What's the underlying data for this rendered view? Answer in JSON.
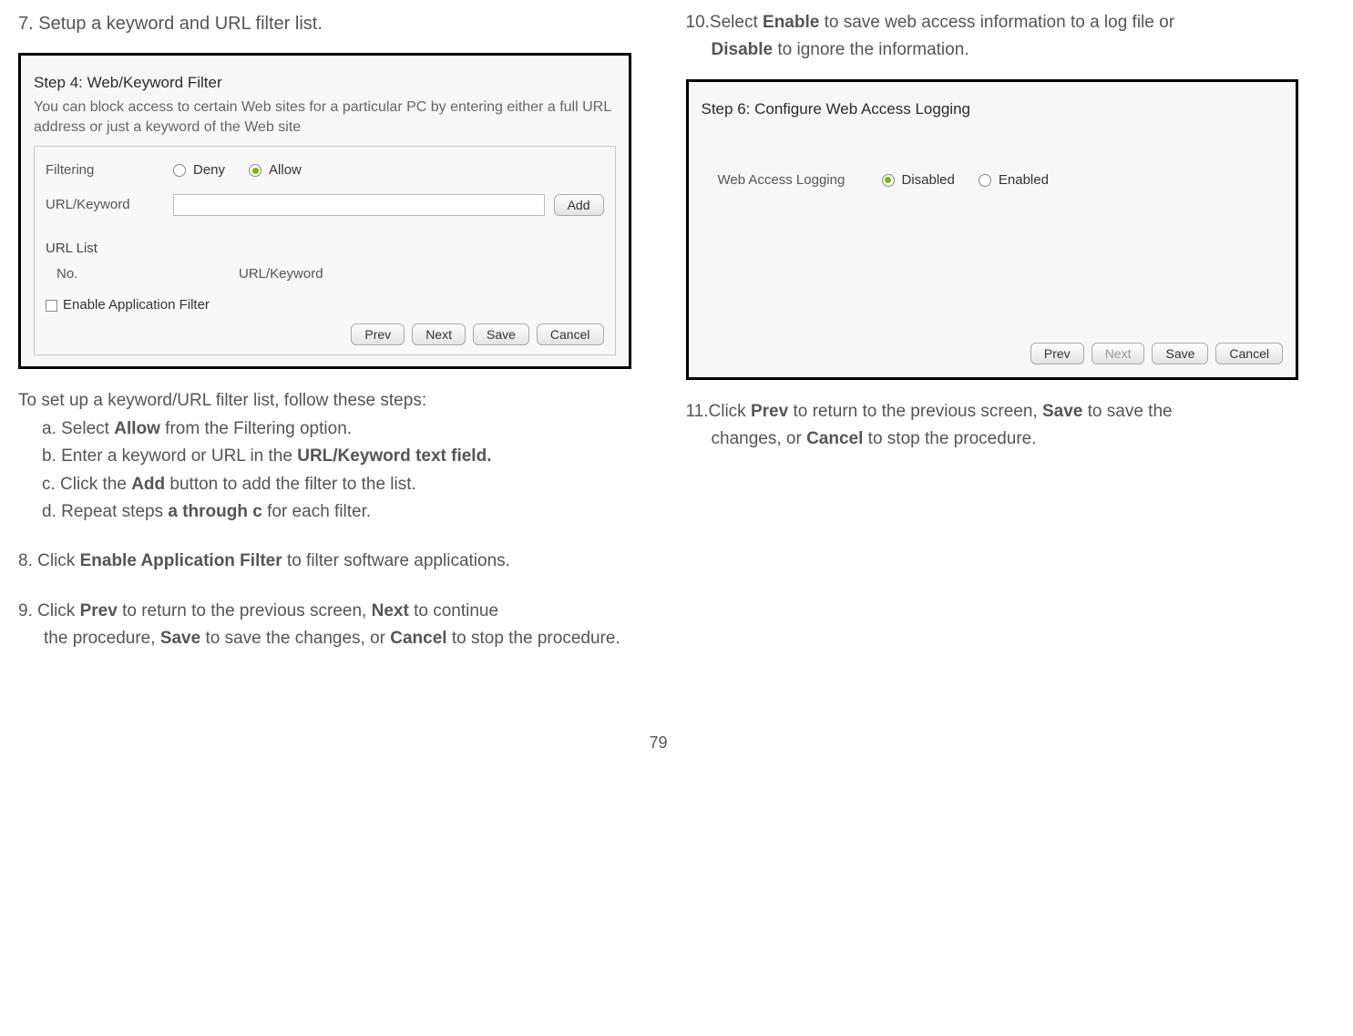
{
  "left": {
    "step7": {
      "num": "7.",
      "text": "Setup a keyword and URL filter list."
    },
    "screenshot1": {
      "title": "Step 4: Web/Keyword Filter",
      "desc": "You can block access to certain Web sites for a particular PC by entering either a full URL address or just a keyword of the Web site",
      "filtering_label": "Filtering",
      "deny": "Deny",
      "allow": "Allow",
      "url_keyword_label": "URL/Keyword",
      "add_btn": "Add",
      "url_list_label": "URL List",
      "col_no": "No.",
      "col_urlkw": "URL/Keyword",
      "enable_app_filter": "Enable Application Filter",
      "prev": "Prev",
      "next": "Next",
      "save": "Save",
      "cancel": "Cancel"
    },
    "instr1": {
      "intro": "To set up a keyword/URL filter list, follow these steps:",
      "a_pre": "a. Select ",
      "a_bold": "Allow",
      "a_post": " from the Filtering option.",
      "b_pre": "b. Enter a keyword or URL in the ",
      "b_bold": "URL/Keyword text field.",
      "c_pre": "c. Click the ",
      "c_bold": "Add",
      "c_post": " button to add the filter to the list.",
      "d_pre": "d. Repeat steps ",
      "d_bold": "a through c",
      "d_post": " for each filter."
    },
    "step8": {
      "num": "8.",
      "pre": "Click ",
      "bold": "Enable Application Filter",
      "post": " to filter software applications."
    },
    "step9": {
      "num": "9.",
      "pre": "Click ",
      "b1": "Prev",
      "t1": " to return to the previous screen, ",
      "b2": "Next",
      "t2": " to continue the procedure, ",
      "b3": "Save",
      "t3": " to save the changes, or ",
      "b4": "Cancel",
      "t4": " to stop the procedure."
    }
  },
  "right": {
    "step10": {
      "num": "10.",
      "pre": "Select ",
      "b1": "Enable",
      "t1": " to save web access information to a log file or ",
      "b2": "Disable",
      "t2": " to ignore the information."
    },
    "screenshot2": {
      "title": "Step 6: Configure Web Access Logging",
      "label": "Web Access Logging",
      "disabled": "Disabled",
      "enabled": "Enabled",
      "prev": "Prev",
      "next": "Next",
      "save": "Save",
      "cancel": "Cancel"
    },
    "step11": {
      "num": "11.",
      "pre": "Click ",
      "b1": "Prev",
      "t1": " to return to the previous screen, ",
      "b2": "Save",
      "t2": " to save the changes, or ",
      "b3": "Cancel",
      "t3": " to stop the procedure."
    }
  },
  "page_number": "79"
}
